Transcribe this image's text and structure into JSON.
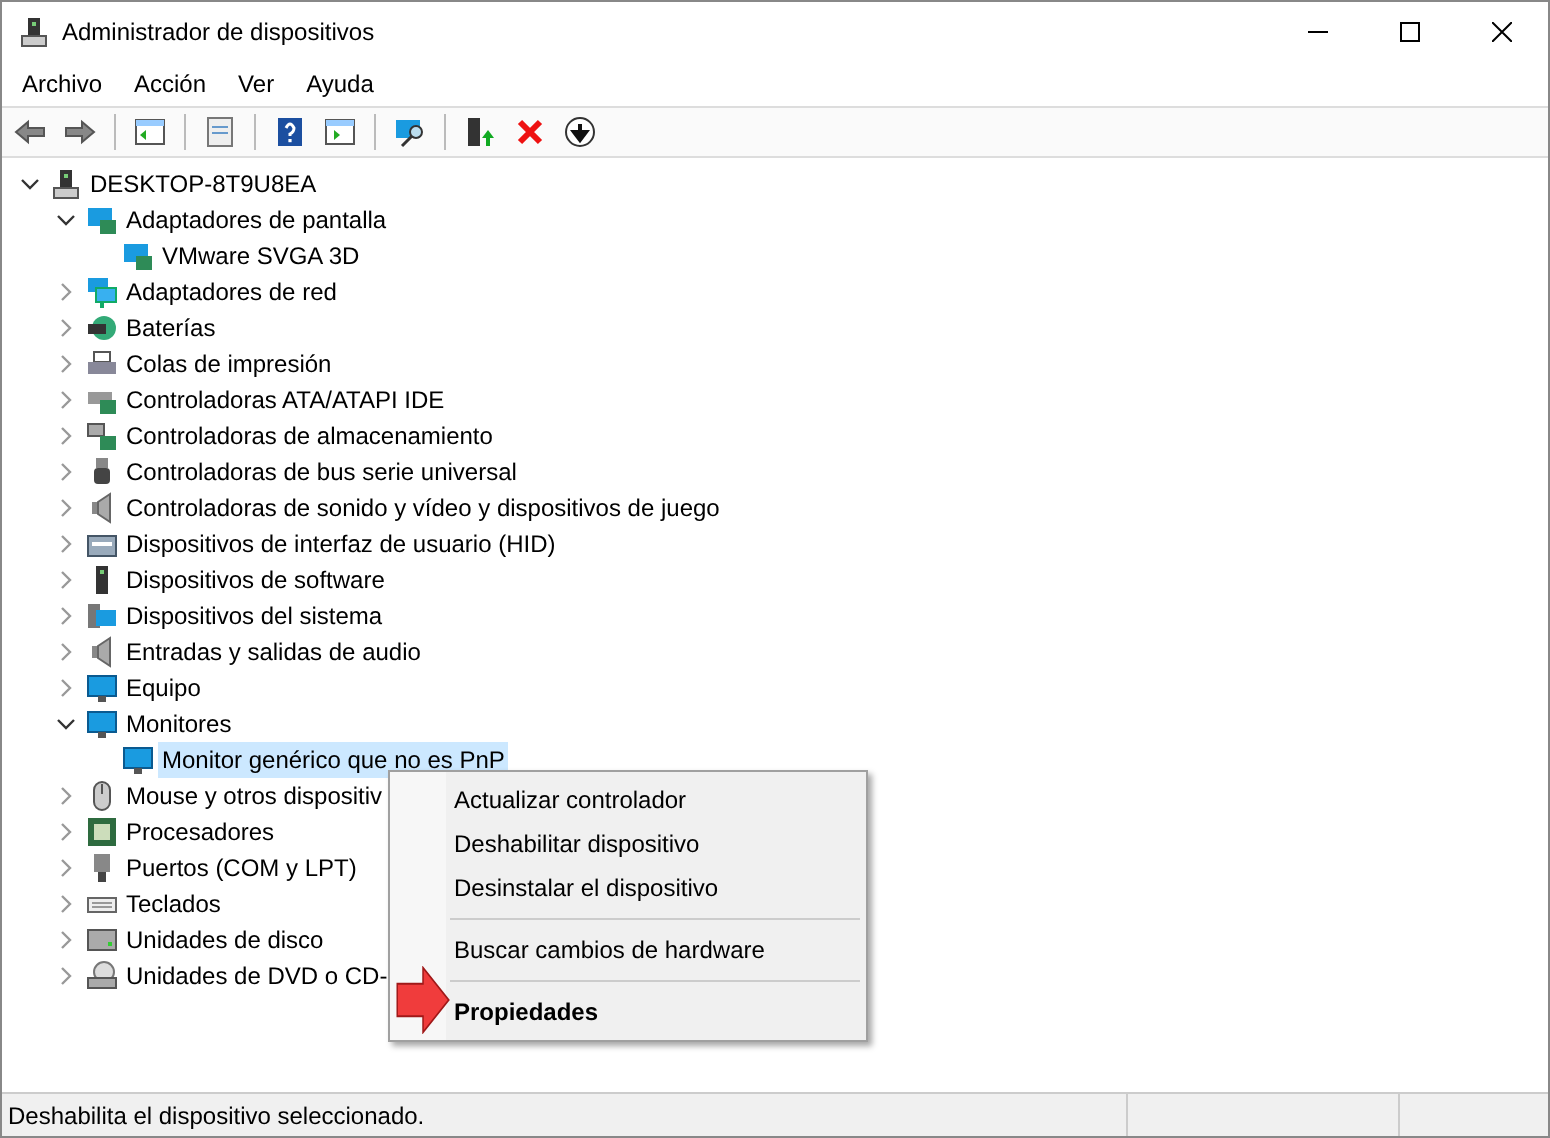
{
  "window": {
    "title": "Administrador de dispositivos"
  },
  "menu": [
    "Archivo",
    "Acción",
    "Ver",
    "Ayuda"
  ],
  "tree": {
    "label": "DESKTOP-8T9U8EA",
    "kind": "computer",
    "expanded": true,
    "selected": false,
    "children": [
      {
        "label": "Adaptadores de pantalla",
        "kind": "display",
        "expanded": true,
        "selected": false,
        "children": [
          {
            "label": "VMware SVGA 3D",
            "kind": "display",
            "selected": false
          }
        ]
      },
      {
        "label": "Adaptadores de red",
        "kind": "network",
        "expanded": false,
        "selected": false
      },
      {
        "label": "Baterías",
        "kind": "battery",
        "expanded": false,
        "selected": false
      },
      {
        "label": "Colas de impresión",
        "kind": "printer",
        "expanded": false,
        "selected": false
      },
      {
        "label": "Controladoras ATA/ATAPI IDE",
        "kind": "ide",
        "expanded": false,
        "selected": false
      },
      {
        "label": "Controladoras de almacenamiento",
        "kind": "storage",
        "expanded": false,
        "selected": false
      },
      {
        "label": "Controladoras de bus serie universal",
        "kind": "usb",
        "expanded": false,
        "selected": false
      },
      {
        "label": "Controladoras de sonido y vídeo y dispositivos de juego",
        "kind": "sound",
        "expanded": false,
        "selected": false
      },
      {
        "label": "Dispositivos de interfaz de usuario (HID)",
        "kind": "hid",
        "expanded": false,
        "selected": false
      },
      {
        "label": "Dispositivos de software",
        "kind": "software",
        "expanded": false,
        "selected": false
      },
      {
        "label": "Dispositivos del sistema",
        "kind": "system",
        "expanded": false,
        "selected": false
      },
      {
        "label": "Entradas y salidas de audio",
        "kind": "sound",
        "expanded": false,
        "selected": false
      },
      {
        "label": "Equipo",
        "kind": "monitor",
        "expanded": false,
        "selected": false
      },
      {
        "label": "Monitores",
        "kind": "monitor",
        "expanded": true,
        "selected": false,
        "children": [
          {
            "label": "Monitor genérico que no es PnP",
            "kind": "monitor",
            "selected": true
          }
        ]
      },
      {
        "label": "Mouse y otros dispositiv",
        "kind": "mouse",
        "expanded": false,
        "selected": false
      },
      {
        "label": "Procesadores",
        "kind": "cpu",
        "expanded": false,
        "selected": false
      },
      {
        "label": "Puertos (COM y LPT)",
        "kind": "port",
        "expanded": false,
        "selected": false
      },
      {
        "label": "Teclados",
        "kind": "keyboard",
        "expanded": false,
        "selected": false
      },
      {
        "label": "Unidades de disco",
        "kind": "disk",
        "expanded": false,
        "selected": false
      },
      {
        "label": "Unidades de DVD o CD-",
        "kind": "dvd",
        "expanded": false,
        "selected": false
      }
    ]
  },
  "context_menu": [
    {
      "kind": "item",
      "label": "Actualizar controlador",
      "default": false
    },
    {
      "kind": "item",
      "label": "Deshabilitar dispositivo",
      "default": false
    },
    {
      "kind": "item",
      "label": "Desinstalar el dispositivo",
      "default": false
    },
    {
      "kind": "separator"
    },
    {
      "kind": "item",
      "label": "Buscar cambios de hardware",
      "default": false
    },
    {
      "kind": "separator"
    },
    {
      "kind": "item",
      "label": "Propiedades",
      "default": true
    }
  ],
  "status_bar": "Deshabilita el dispositivo seleccionado."
}
